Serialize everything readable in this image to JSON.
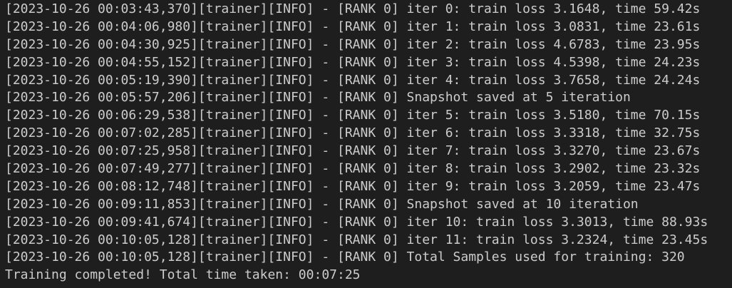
{
  "terminal": {
    "lines": [
      "[2023-10-26 00:03:43,370][trainer][INFO] - [RANK 0] iter 0: train loss 3.1648, time 59.42s",
      "[2023-10-26 00:04:06,980][trainer][INFO] - [RANK 0] iter 1: train loss 3.0831, time 23.61s",
      "[2023-10-26 00:04:30,925][trainer][INFO] - [RANK 0] iter 2: train loss 4.6783, time 23.95s",
      "[2023-10-26 00:04:55,152][trainer][INFO] - [RANK 0] iter 3: train loss 4.5398, time 24.23s",
      "[2023-10-26 00:05:19,390][trainer][INFO] - [RANK 0] iter 4: train loss 3.7658, time 24.24s",
      "[2023-10-26 00:05:57,206][trainer][INFO] - [RANK 0] Snapshot saved at 5 iteration",
      "[2023-10-26 00:06:29,538][trainer][INFO] - [RANK 0] iter 5: train loss 3.5180, time 70.15s",
      "[2023-10-26 00:07:02,285][trainer][INFO] - [RANK 0] iter 6: train loss 3.3318, time 32.75s",
      "[2023-10-26 00:07:25,958][trainer][INFO] - [RANK 0] iter 7: train loss 3.3270, time 23.67s",
      "[2023-10-26 00:07:49,277][trainer][INFO] - [RANK 0] iter 8: train loss 3.2902, time 23.32s",
      "[2023-10-26 00:08:12,748][trainer][INFO] - [RANK 0] iter 9: train loss 3.2059, time 23.47s",
      "[2023-10-26 00:09:11,853][trainer][INFO] - [RANK 0] Snapshot saved at 10 iteration",
      "[2023-10-26 00:09:41,674][trainer][INFO] - [RANK 0] iter 10: train loss 3.3013, time 88.93s",
      "[2023-10-26 00:10:05,128][trainer][INFO] - [RANK 0] iter 11: train loss 3.2324, time 23.45s",
      "[2023-10-26 00:10:05,128][trainer][INFO] - [RANK 0] Total Samples used for training: 320",
      "Training completed! Total time taken: 00:07:25"
    ]
  },
  "colors": {
    "background": "#1e1e1e",
    "text": "#cccccc"
  }
}
